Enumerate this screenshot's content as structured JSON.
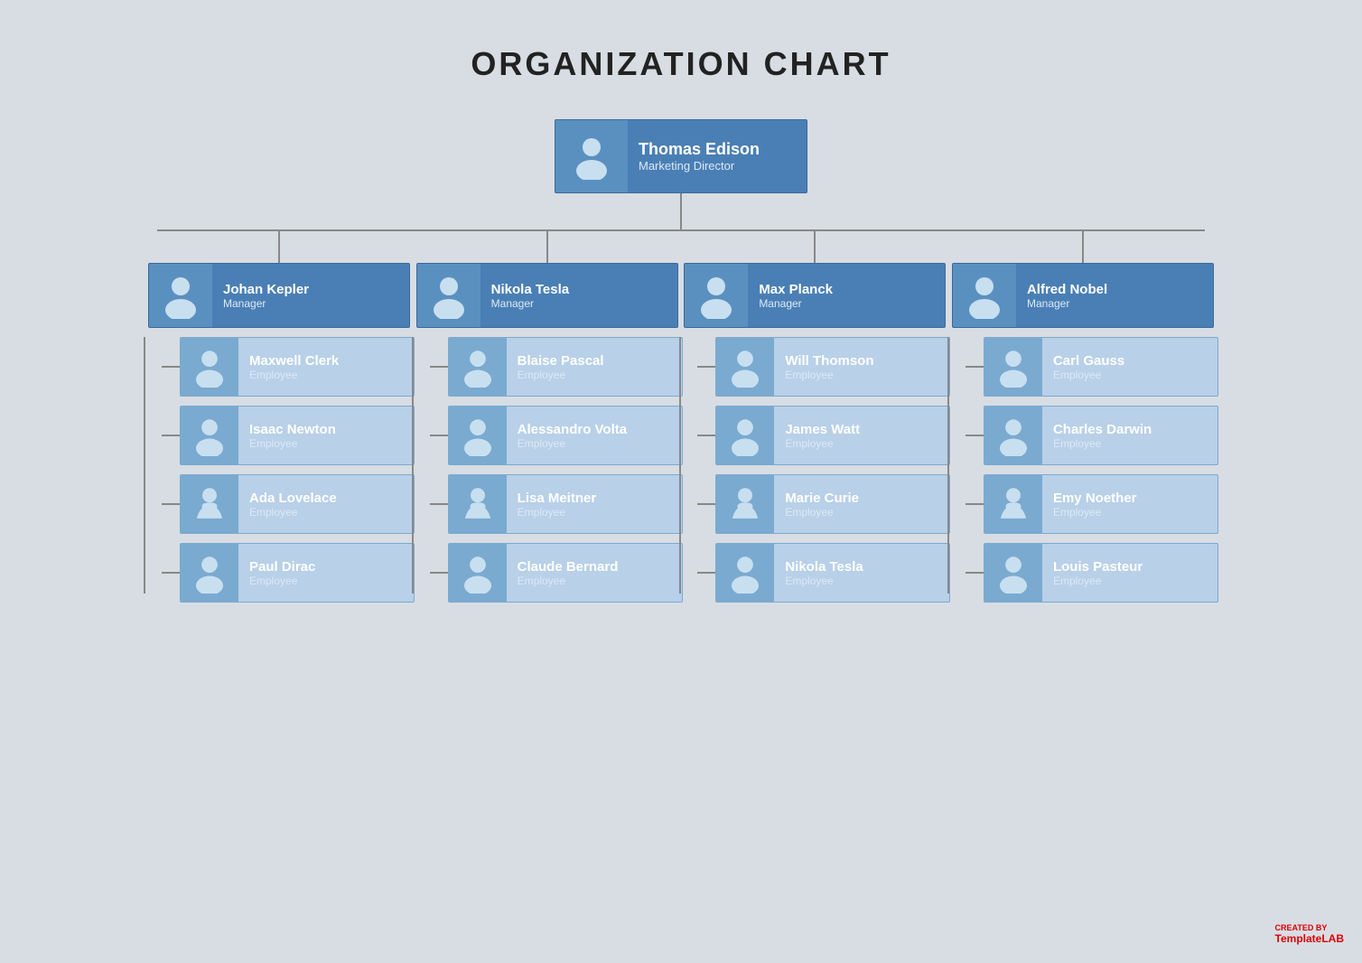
{
  "title": "ORGANIZATION CHART",
  "root": {
    "name": "Thomas Edison",
    "role": "Marketing Director"
  },
  "managers": [
    {
      "name": "Johan Kepler",
      "role": "Manager"
    },
    {
      "name": "Nikola Tesla",
      "role": "Manager"
    },
    {
      "name": "Max Planck",
      "role": "Manager"
    },
    {
      "name": "Alfred Nobel",
      "role": "Manager"
    }
  ],
  "employees": [
    [
      {
        "name": "Maxwell Clerk",
        "role": "Employee"
      },
      {
        "name": "Isaac Newton",
        "role": "Employee"
      },
      {
        "name": "Ada Lovelace",
        "role": "Employee"
      },
      {
        "name": "Paul Dirac",
        "role": "Employee"
      }
    ],
    [
      {
        "name": "Blaise Pascal",
        "role": "Employee"
      },
      {
        "name": "Alessandro Volta",
        "role": "Employee"
      },
      {
        "name": "Lisa Meitner",
        "role": "Employee"
      },
      {
        "name": "Claude Bernard",
        "role": "Employee"
      }
    ],
    [
      {
        "name": "Will Thomson",
        "role": "Employee"
      },
      {
        "name": "James Watt",
        "role": "Employee"
      },
      {
        "name": "Marie Curie",
        "role": "Employee"
      },
      {
        "name": "Nikola Tesla",
        "role": "Employee"
      }
    ],
    [
      {
        "name": "Carl Gauss",
        "role": "Employee"
      },
      {
        "name": "Charles Darwin",
        "role": "Employee"
      },
      {
        "name": "Emy Noether",
        "role": "Employee"
      },
      {
        "name": "Louis Pasteur",
        "role": "Employee"
      }
    ]
  ],
  "watermark": {
    "created_by": "CREATED BY",
    "brand": "Template",
    "brand_highlight": "LAB"
  },
  "avatar_male": "male",
  "avatar_female": "female"
}
